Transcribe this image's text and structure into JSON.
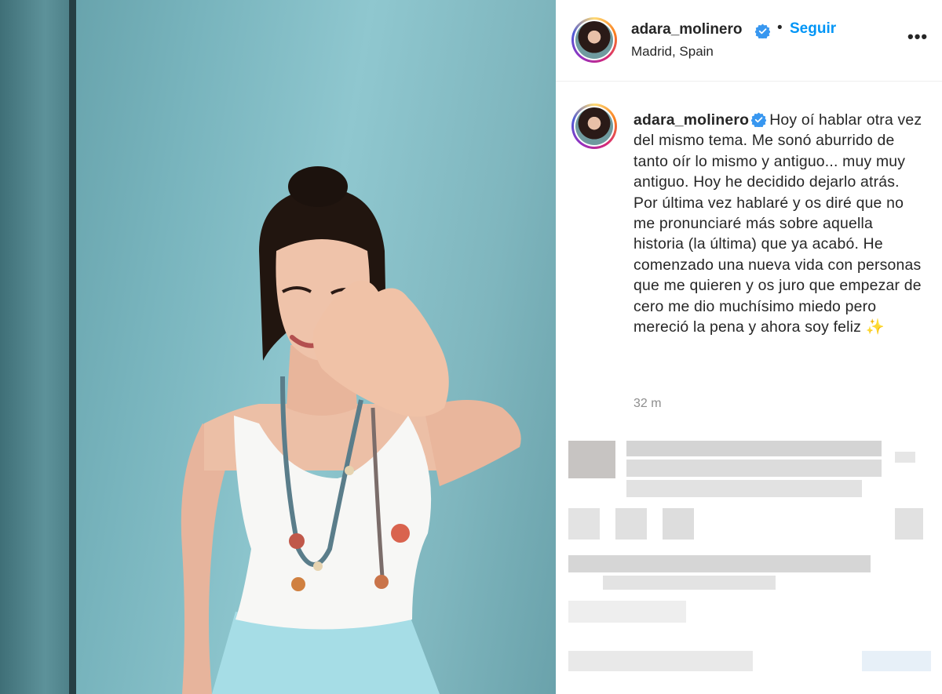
{
  "post": {
    "username": "adara_molinero",
    "location": "Madrid, Spain",
    "follow_label": "Seguir",
    "dot_separator": "•",
    "more_label": "•••"
  },
  "caption": {
    "username": "adara_molinero",
    "text": "Hoy oí hablar otra vez del mismo tema. Me sonó aburrido de tanto oír lo mismo y antiguo... muy muy antiguo. Hoy he decidido dejarlo atrás. Por última vez hablaré y os diré que no me pronunciaré más sobre aquella historia (la última) que ya acabó. He comenzado una nueva vida con personas que me quieren y os juro que empezar de cero me dio muchísimo miedo pero mereció la pena y ahora soy feliz ✨",
    "timestamp": "32 m"
  },
  "colors": {
    "accent": "#0095f6",
    "verified": "#3897f0",
    "text": "#262626",
    "muted": "#8e8e8e"
  },
  "icons": {
    "verified": "verified-badge-icon",
    "more": "more-options-icon"
  }
}
